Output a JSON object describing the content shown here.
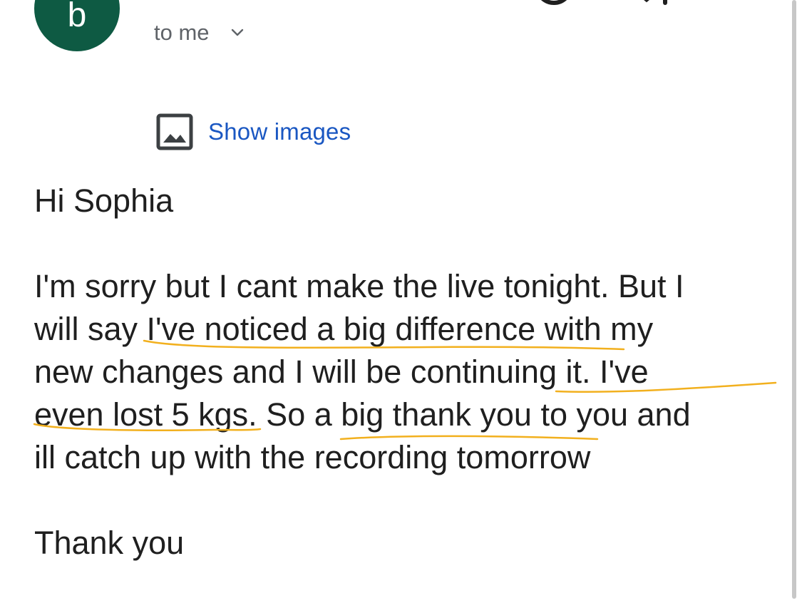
{
  "sender": {
    "avatar_letter": "b",
    "avatar_color": "#0e5a43"
  },
  "recipient": {
    "label": "to me",
    "expand_icon": "chevron-down-icon"
  },
  "images_prompt": {
    "icon": "image-icon",
    "label": "Show images"
  },
  "message": {
    "greeting": "Hi Sophia",
    "paragraph_lines": [
      "I'm sorry but I cant make the live tonight. But I",
      "will say I've noticed a big difference with my",
      "new changes and I will be continuing it. I've",
      "even lost 5 kgs. So a big thank you to you and",
      "ill catch up with the recording tomorrow"
    ],
    "signoff": "Thank you"
  },
  "colors": {
    "link": "#1a57c2",
    "highlight_underline": "#f2b01e",
    "text": "#1f1f1f",
    "secondary_text": "#5f6368"
  }
}
